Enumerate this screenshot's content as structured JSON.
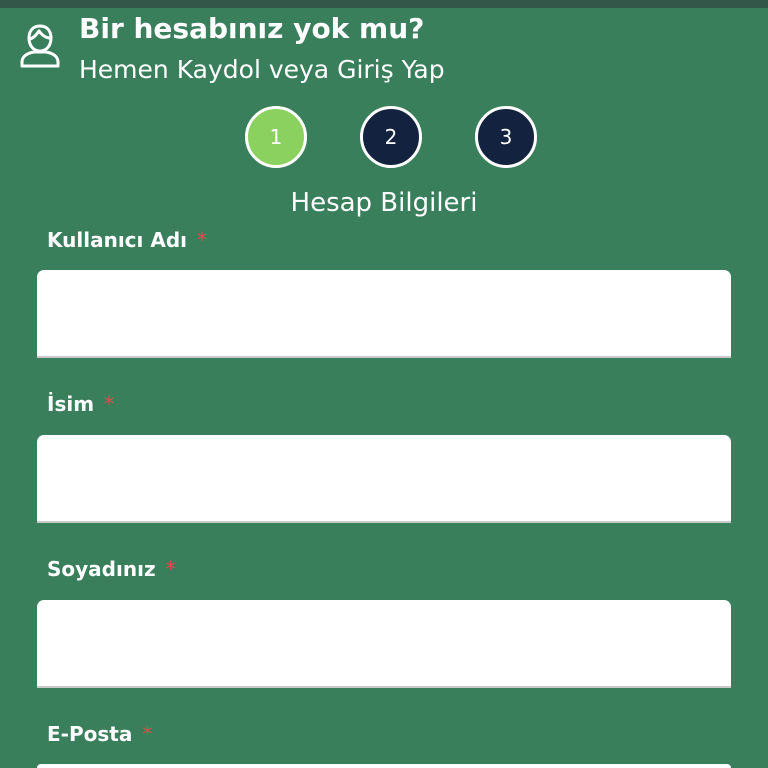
{
  "colors": {
    "background": "#3a7f5c",
    "top_strip": "#33584a",
    "step_active": "#8bd15f",
    "step_inactive": "#13233f",
    "required_asterisk": "#e04b4b",
    "input_background": "#ffffff"
  },
  "header": {
    "icon": "user-icon",
    "title": "Bir hesabınız yok mu?",
    "subtitle": "Hemen Kaydol veya Giriş Yap"
  },
  "steps": [
    {
      "label": "1",
      "state": "active"
    },
    {
      "label": "2",
      "state": "inactive"
    },
    {
      "label": "3",
      "state": "inactive"
    }
  ],
  "section_title": "Hesap Bilgileri",
  "form": {
    "fields": [
      {
        "label": "Kullanıcı Adı",
        "required_mark": "*",
        "value": "",
        "placeholder": ""
      },
      {
        "label": "İsim",
        "required_mark": "*",
        "value": "",
        "placeholder": ""
      },
      {
        "label": "Soyadınız",
        "required_mark": "*",
        "value": "",
        "placeholder": ""
      },
      {
        "label": "E-Posta",
        "required_mark": "*",
        "value": "",
        "placeholder": ""
      }
    ]
  }
}
